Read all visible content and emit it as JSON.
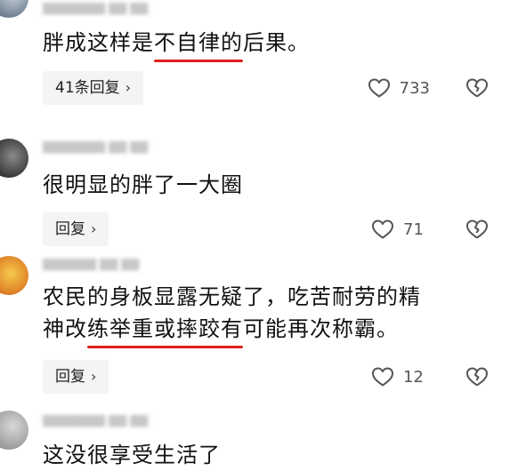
{
  "comments": [
    {
      "text_before": "胖成这样是",
      "text_highlight": "不自律的",
      "text_after": "后果。",
      "reply_label": "41条回复",
      "likes": "733"
    },
    {
      "text": "很明显的胖了一大圈",
      "reply_label": "回复",
      "likes": "71"
    },
    {
      "line1": "农民的身板显露无疑了，吃苦耐劳的精",
      "line2_before": "神改",
      "line2_highlight": "练举重或摔跤有",
      "line2_after": "可能再次称霸。",
      "reply_label": "回复",
      "likes": "12"
    },
    {
      "text": "这没很享受生活了"
    }
  ],
  "icons": {
    "like": "heart-outline-icon",
    "dislike": "broken-heart-icon",
    "chevron": "chevron-right-icon"
  },
  "colors": {
    "highlight_underline": "#e0201c",
    "reply_bg": "#f4f4f4"
  }
}
